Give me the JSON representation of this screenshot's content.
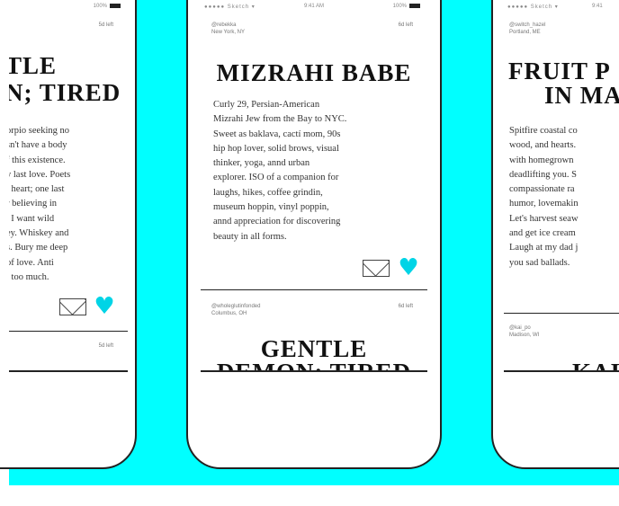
{
  "colors": {
    "background": "#00ffff",
    "phone_stroke": "#222222",
    "heart": "#00d4e6"
  },
  "left_phone": {
    "status_time": "",
    "status_battery": "100%",
    "card1": {
      "left_time": "5d left",
      "title_lines": [
        "TLE",
        "N; TIRED"
      ],
      "bio_lines": [
        "orpio seeking no",
        "sn't have a body",
        "f this existence.",
        "y last love. Poets",
        "l heart; one last",
        "r believing in",
        ". I want wild",
        "ey. Whiskey and",
        "s. Bury me deep",
        "of love. Anti",
        "t too much."
      ],
      "message_icon": "envelope-icon",
      "like_icon": "heart-icon"
    },
    "card2": {
      "left_time": "5d left"
    }
  },
  "center_phone": {
    "status_carrier": "Sketch",
    "status_time": "9:41 AM",
    "status_battery": "100%",
    "card1": {
      "username": "@rebekka",
      "location": "New York, NY",
      "left_time": "6d left",
      "title": "MIZRAHI BABE",
      "bio_lines": [
        "Curly 29, Persian-American",
        "Mizrahi Jew from the Bay to NYC.",
        "Sweet as baklava, cactí mom, 90s",
        "hip hop lover, solid brows, visual",
        "thinker, yoga, annd urban",
        "explorer. ISO of a companion for",
        "laughs, hikes, coffee grindin,",
        "museum hoppin, vinyl poppin,",
        "annd appreciation for discovering",
        "beauty in all forms."
      ],
      "message_icon": "envelope-icon",
      "like_icon": "heart-icon"
    },
    "card2": {
      "username": "@wholeglutinfonded",
      "location": "Columbus, OH",
      "left_time": "6d left",
      "title_lines": [
        "GENTLE",
        "DEMON; TIRED"
      ]
    }
  },
  "right_phone": {
    "status_carrier": "Sketch",
    "status_time": "9:41",
    "card1": {
      "username": "@switch_hazel",
      "location": "Portland, ME",
      "title_lines": [
        "FRUIT P",
        "IN MA"
      ],
      "bio_lines": [
        "Spitfire coastal co",
        "wood, and hearts.",
        "with homegrown",
        "deadlifting you. S",
        "compassionate ra",
        "humor, lovemakin",
        "Let's harvest seaw",
        "and get ice cream",
        "Laugh at my dad j",
        "you sad ballads."
      ]
    },
    "card2": {
      "username": "@kai_po",
      "location": "Madison, WI",
      "title_lines": [
        "KAI"
      ]
    }
  }
}
